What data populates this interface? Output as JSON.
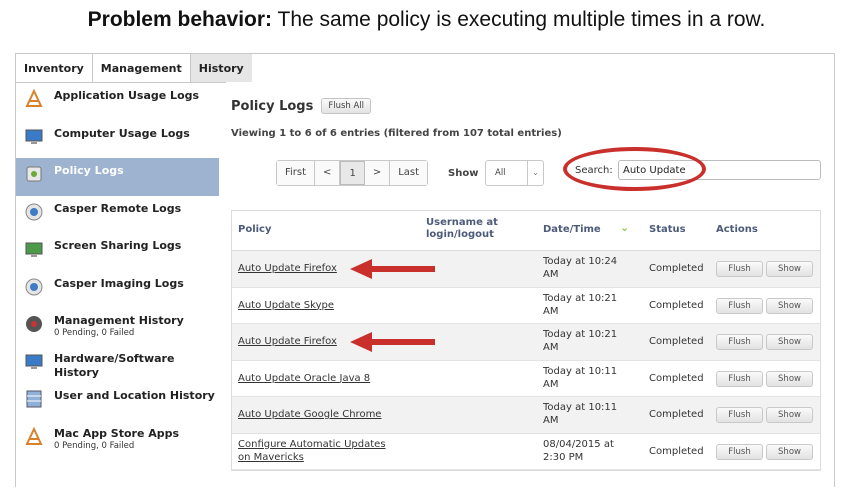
{
  "headline": {
    "bold": "Problem behavior:",
    "rest": " The same policy is executing multiple times in a row."
  },
  "tabs": [
    "Inventory",
    "Management",
    "History"
  ],
  "sidebar": {
    "items": [
      {
        "label": "Application Usage Logs",
        "sub": "",
        "icon": "application-usage-icon"
      },
      {
        "label": "Computer Usage Logs",
        "sub": "",
        "icon": "computer-icon"
      },
      {
        "label": "Policy Logs",
        "sub": "",
        "icon": "policy-icon"
      },
      {
        "label": "Casper Remote Logs",
        "sub": "",
        "icon": "casper-remote-icon"
      },
      {
        "label": "Screen Sharing Logs",
        "sub": "",
        "icon": "screen-sharing-icon"
      },
      {
        "label": "Casper Imaging Logs",
        "sub": "",
        "icon": "casper-imaging-icon"
      },
      {
        "label": "Management History",
        "sub": "0 Pending, 0 Failed",
        "icon": "management-history-icon"
      },
      {
        "label": "Hardware/Software History",
        "sub": "",
        "icon": "hardware-software-icon"
      },
      {
        "label": "User and Location History",
        "sub": "",
        "icon": "user-location-icon"
      },
      {
        "label": "Mac App Store Apps",
        "sub": "0 Pending, 0 Failed",
        "icon": "app-store-icon"
      }
    ]
  },
  "main": {
    "title": "Policy Logs",
    "flush_all": "Flush All",
    "viewing": "Viewing 1 to 6 of 6 entries (filtered from 107 total entries)",
    "pager": {
      "first": "First",
      "prev": "<",
      "page": "1",
      "next": ">",
      "last": "Last"
    },
    "show_label": "Show",
    "show_value": "All",
    "search_label": "Search:",
    "search_value": "Auto Update"
  },
  "table": {
    "headers": {
      "policy": "Policy",
      "username": "Username at login/logout",
      "datetime": "Date/Time",
      "status": "Status",
      "actions": "Actions"
    },
    "flush_label": "Flush",
    "show_label": "Show",
    "rows": [
      {
        "policy": "Auto Update Firefox",
        "dt1": "Today at 10:24",
        "dt2": "AM",
        "status": "Completed",
        "arrow": true
      },
      {
        "policy": "Auto Update Skype",
        "dt1": "Today at 10:21",
        "dt2": "AM",
        "status": "Completed",
        "arrow": false
      },
      {
        "policy": "Auto Update Firefox",
        "dt1": "Today at 10:21",
        "dt2": "AM",
        "status": "Completed",
        "arrow": true
      },
      {
        "policy": "Auto Update Oracle Java 8",
        "dt1": "Today at 10:11",
        "dt2": "AM",
        "status": "Completed",
        "arrow": false
      },
      {
        "policy": "Auto Update Google Chrome",
        "dt1": "Today at 10:11",
        "dt2": "AM",
        "status": "Completed",
        "arrow": false
      },
      {
        "policy": "Configure Automatic Updates",
        "policy2": "on Mavericks",
        "dt1": "08/04/2015 at",
        "dt2": "2:30 PM",
        "status": "Completed",
        "arrow": false
      }
    ]
  },
  "colors": {
    "active_sidebar": "#9db3cf",
    "annotation_red": "#c9302c",
    "header_text": "#4d5b7a"
  }
}
